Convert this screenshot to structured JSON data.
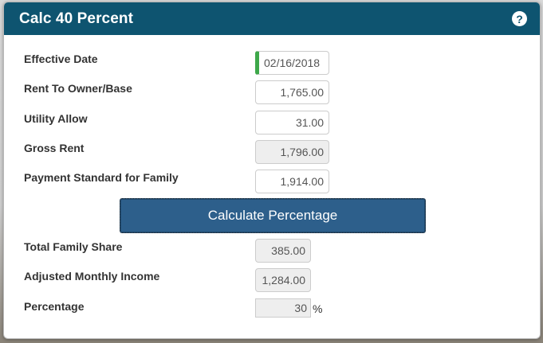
{
  "dialog": {
    "title": "Calc 40 Percent",
    "help_icon": "question-circle-icon"
  },
  "fields": {
    "effective_date": {
      "label": "Effective Date",
      "value": "02/16/2018"
    },
    "rent_to_owner": {
      "label": "Rent To Owner/Base",
      "value": "1,765.00"
    },
    "utility_allow": {
      "label": "Utility Allow",
      "value": "31.00"
    },
    "gross_rent": {
      "label": "Gross Rent",
      "value": "1,796.00"
    },
    "payment_standard": {
      "label": "Payment Standard for Family",
      "value": "1,914.00"
    }
  },
  "calculate_button": {
    "label": "Calculate Percentage"
  },
  "results": {
    "total_family_share": {
      "label": "Total Family Share",
      "value": "385.00"
    },
    "adjusted_monthly_income": {
      "label": "Adjusted Monthly Income",
      "value": "1,284.00"
    },
    "percentage": {
      "label": "Percentage",
      "value": "30",
      "unit": "%"
    }
  },
  "colors": {
    "header": "#0e5470",
    "button": "#2d5f8b",
    "date_accent": "#3ea84a"
  }
}
